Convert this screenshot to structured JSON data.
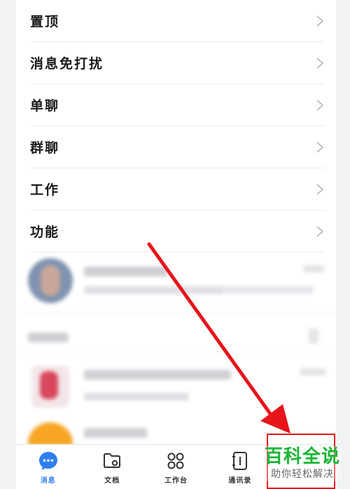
{
  "menu": {
    "items": [
      {
        "label": "置顶"
      },
      {
        "label": "消息免打扰"
      },
      {
        "label": "单聊"
      },
      {
        "label": "群聊"
      },
      {
        "label": "工作"
      },
      {
        "label": "功能"
      }
    ]
  },
  "tabbar": {
    "tabs": [
      {
        "label": "消息",
        "icon": "chat-bubble-icon",
        "active": true
      },
      {
        "label": "文档",
        "icon": "folder-icon"
      },
      {
        "label": "工作台",
        "icon": "grid-icon"
      },
      {
        "label": "通讯录",
        "icon": "contacts-book-icon"
      },
      {
        "label": ""
      }
    ]
  },
  "watermark": {
    "main": "百科全说",
    "sub": "助你轻松解决"
  },
  "colors": {
    "accent": "#2f7ff0",
    "annotation": "#e8141c",
    "watermark": "#18b534"
  }
}
